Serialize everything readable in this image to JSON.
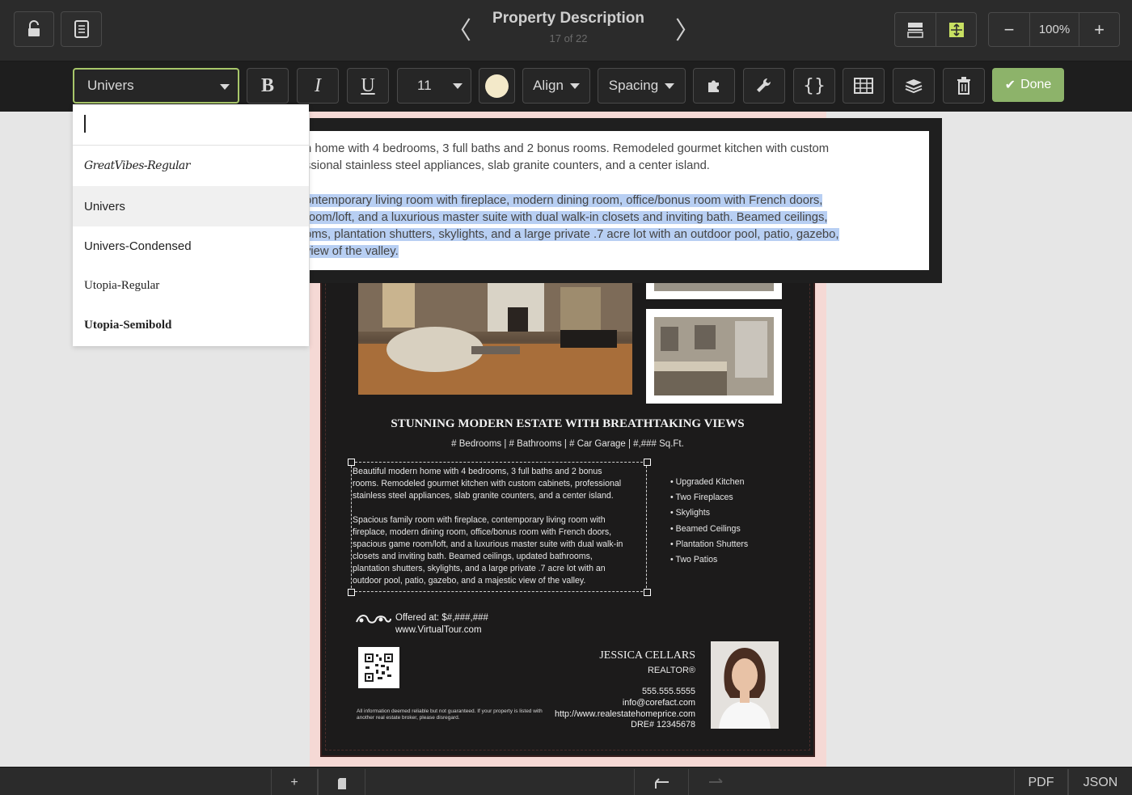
{
  "header": {
    "title": "Property Description",
    "subtitle": "17 of 22",
    "zoom": "100%",
    "prev_icon": "chevron-left-icon",
    "next_icon": "chevron-right-icon"
  },
  "toolbar": {
    "font_value": "Univers",
    "bold": "B",
    "italic": "I",
    "underline": "U",
    "font_size": "11",
    "text_color": "#f3e9c9",
    "align_label": "Align",
    "spacing_label": "Spacing",
    "done_label": "Done",
    "accent": "#8db36a"
  },
  "font_dropdown": {
    "search_value": "",
    "options": [
      "GreatVibes-Regular",
      "Univers",
      "Univers-Condensed",
      "Utopia-Regular",
      "Utopia-Semibold"
    ],
    "selected": "Univers"
  },
  "editor": {
    "para1_line1": "n home with 4 bedrooms, 3 full baths and 2 bonus rooms. Remodeled gourmet kitchen with custom",
    "para1_line2": "ssional stainless steel appliances, slab granite counters, and a center island.",
    "para2_line1": "ontemporary living room with fireplace, modern dining room, office/bonus room with French doors,",
    "para2_line2": "room/loft, and a luxurious master suite with dual walk-in closets and inviting bath. Beamed ceilings,",
    "para2_line3": "oms, plantation shutters, skylights, and a large private .7 acre lot with an outdoor pool, patio, gazebo,",
    "para2_line4": "view of the valley."
  },
  "flyer": {
    "headline": "STUNNING MODERN ESTATE WITH BREATHTAKING VIEWS",
    "subline": "# Bedrooms | # Bathrooms | # Car Garage | #,### Sq.Ft.",
    "description": "Beautiful modern home with 4 bedrooms, 3 full baths and 2 bonus\nrooms. Remodeled gourmet kitchen with custom cabinets, professional\nstainless steel appliances, slab granite counters, and a center island.\n\nSpacious family room with fireplace, contemporary living room with\nfireplace, modern dining room, office/bonus room with French doors,\nspacious game room/loft, and a luxurious master suite with dual walk-in\nclosets and inviting bath. Beamed ceilings, updated bathrooms,\nplantation shutters, skylights, and a large private .7 acre lot with an\noutdoor pool, patio, gazebo, and a majestic view of the valley.",
    "features": [
      "• Upgraded Kitchen",
      "• Two Fireplaces",
      "• Skylights",
      "• Beamed Ceilings",
      "• Plantation Shutters",
      "• Two Patios"
    ],
    "offer_line": "Offered at: $#,###,###",
    "tour_url": "www.VirtualTour.com",
    "disclaimer": "All information deemed reliable but not guaranteed. If your property is listed with another real estate broker, please disregard.",
    "agent_name": "JESSICA CELLARS",
    "agent_title": "REALTOR®",
    "phone": "555.555.5555",
    "email": "info@corefact.com",
    "website": "http://www.realestatehomeprice.com",
    "license": "DRE# 12345678"
  },
  "footer": {
    "add_label": "+",
    "pdf_label": "PDF",
    "json_label": "JSON"
  }
}
